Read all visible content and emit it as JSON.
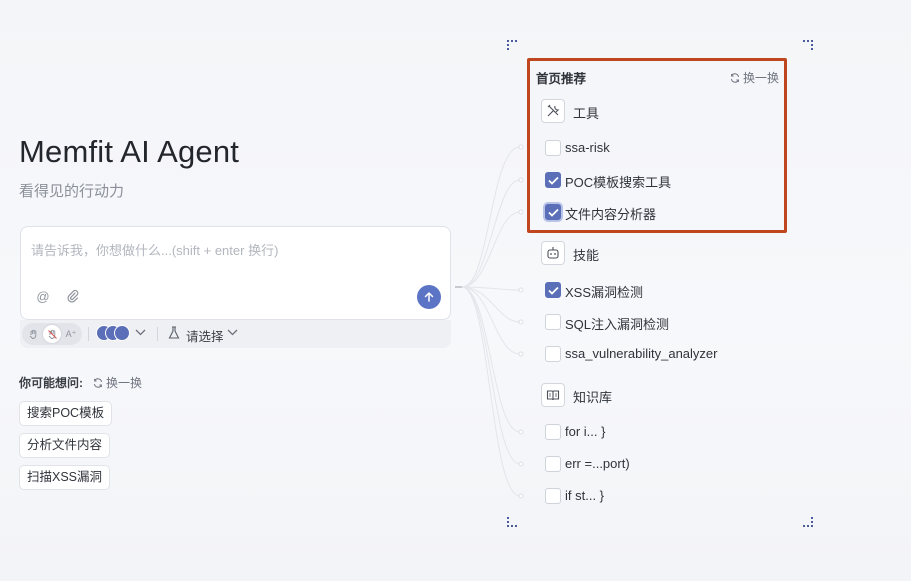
{
  "hero": {
    "title": "Memfit AI Agent",
    "subtitle": "看得见的行动力"
  },
  "chat": {
    "placeholder": "请告诉我，你想做什么...(shift + enter 换行)",
    "select_label": "请选择"
  },
  "suggestions": {
    "heading": "你可能想问:",
    "refresh_label": "换一换",
    "items": [
      "搜索POC模板",
      "分析文件内容",
      "扫描XSS漏洞"
    ]
  },
  "tree": {
    "heading": "首页推荐",
    "refresh_label": "换一换",
    "groups": [
      {
        "label": "工具",
        "icon": "tools-icon",
        "items": [
          {
            "label": "ssa-risk",
            "checked": false
          },
          {
            "label": "POC模板搜索工具",
            "checked": true
          },
          {
            "label": "文件内容分析器",
            "checked": true
          }
        ]
      },
      {
        "label": "技能",
        "icon": "robot-icon",
        "items": [
          {
            "label": "XSS漏洞检测",
            "checked": true
          },
          {
            "label": "SQL注入漏洞检测",
            "checked": false
          },
          {
            "label": "ssa_vulnerability_analyzer",
            "checked": false
          }
        ]
      },
      {
        "label": "知识库",
        "icon": "book-icon",
        "items": [
          {
            "label": "for i... }",
            "checked": false
          },
          {
            "label": "err =...port)",
            "checked": false
          },
          {
            "label": "if st... }",
            "checked": false
          }
        ]
      }
    ]
  },
  "colors": {
    "accent": "#5b6fb8",
    "highlight": "#c0461f"
  }
}
